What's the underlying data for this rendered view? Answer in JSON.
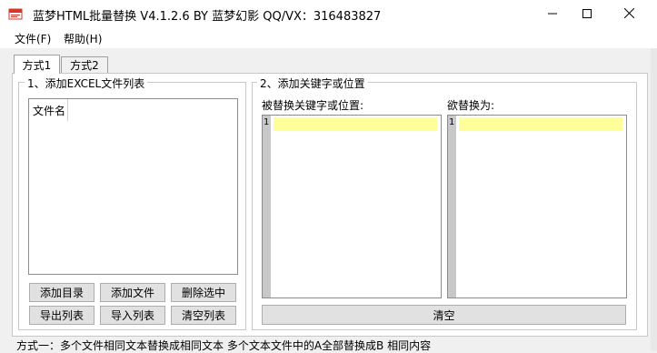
{
  "window": {
    "title": "蓝梦HTML批量替换 V4.1.2.6 BY 蓝梦幻影 QQ/VX：316483827",
    "minimize_glyph": "—",
    "maximize_glyph": "☐",
    "close_glyph": "✕"
  },
  "menu": {
    "items": [
      {
        "label": "文件(F)"
      },
      {
        "label": "帮助(H)"
      }
    ]
  },
  "tabs": [
    {
      "label": "方式1",
      "active": true
    },
    {
      "label": "方式2",
      "active": false
    }
  ],
  "file_group": {
    "legend": "1、添加EXCEL文件列表",
    "column_header": "文件名",
    "buttons": {
      "add_dir": "添加目录",
      "add_file": "添加文件",
      "delete_selected": "删除选中",
      "export_list": "导出列表",
      "import_list": "导入列表",
      "clear_list": "清空列表"
    }
  },
  "replace_group": {
    "legend": "2、添加关键字或位置",
    "find_label": "被替换关键字或位置:",
    "replace_label": "欲替换为:",
    "find_line_number": "1",
    "replace_line_number": "1",
    "clear_button": "清空"
  },
  "status": {
    "text": "方式一：多个文件相同文本替换成相同文本   多个文本文件中的A全部替换成B 相同内容"
  },
  "colors": {
    "highlight_line": "#ffff99",
    "gutter": "#c8c8c8",
    "icon_red": "#d9342b"
  }
}
